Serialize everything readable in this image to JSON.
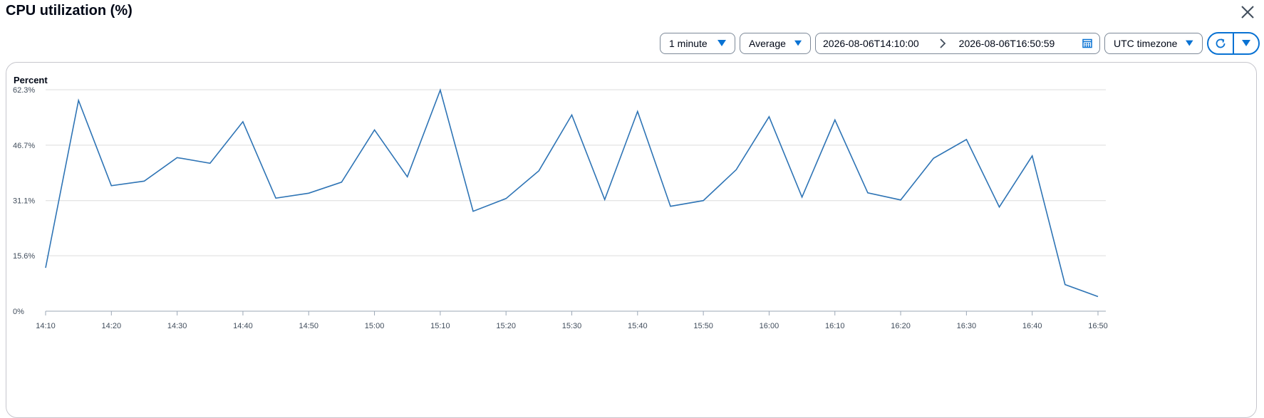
{
  "header": {
    "title": "CPU utilization (%)"
  },
  "toolbar": {
    "interval": "1 minute",
    "statistic": "Average",
    "range_start": "2026-08-06T14:10:00",
    "range_end": "2026-08-06T16:50:59",
    "timezone": "UTC timezone"
  },
  "icons": {
    "close": "close-icon",
    "caret": "caret-down-icon",
    "calendar": "calendar-icon",
    "refresh": "refresh-icon",
    "chevron_right": "chevron-right-icon"
  },
  "colors": {
    "accent": "#0972d3",
    "line": "#2e74b5",
    "grid": "#dcdcdc"
  },
  "chart_data": {
    "type": "line",
    "ylabel": "Percent",
    "ylim": [
      0,
      62.3
    ],
    "yticks": [
      "0%",
      "15.6%",
      "31.1%",
      "46.7%",
      "62.3%"
    ],
    "ytick_values": [
      0,
      15.6,
      31.1,
      46.7,
      62.3
    ],
    "xticks": [
      "14:10",
      "14:20",
      "14:30",
      "14:40",
      "14:50",
      "15:00",
      "15:10",
      "15:20",
      "15:30",
      "15:40",
      "15:50",
      "16:00",
      "16:10",
      "16:20",
      "16:30",
      "16:40",
      "16:50"
    ],
    "x": [
      "14:10",
      "14:15",
      "14:20",
      "14:25",
      "14:30",
      "14:35",
      "14:40",
      "14:45",
      "14:50",
      "14:55",
      "15:00",
      "15:05",
      "15:10",
      "15:15",
      "15:20",
      "15:25",
      "15:30",
      "15:35",
      "15:40",
      "15:45",
      "15:50",
      "15:55",
      "16:00",
      "16:05",
      "16:10",
      "16:15",
      "16:20",
      "16:25",
      "16:30",
      "16:35",
      "16:40",
      "16:45",
      "16:50"
    ],
    "series": [
      {
        "values": [
          12.2,
          59.3,
          35.3,
          36.6,
          43.2,
          41.6,
          53.3,
          31.8,
          33.2,
          36.3,
          51.0,
          37.8,
          62.2,
          28.1,
          31.7,
          39.5,
          55.2,
          31.4,
          56.2,
          29.5,
          31.1,
          39.8,
          54.7,
          32.1,
          53.8,
          33.3,
          31.3,
          43.0,
          48.3,
          29.3,
          43.7,
          7.5,
          4.1
        ]
      }
    ],
    "grid": true,
    "legend": "none"
  }
}
